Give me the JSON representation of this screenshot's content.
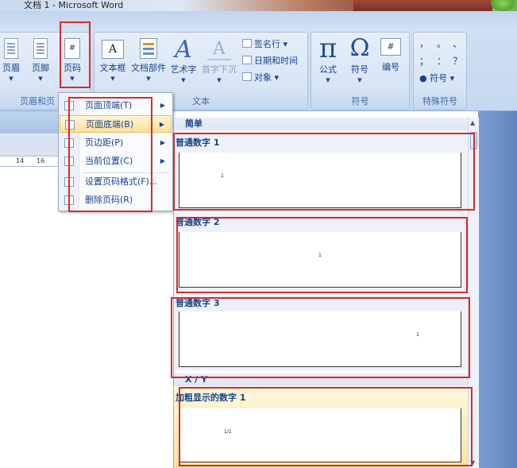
{
  "window": {
    "title": "文档 1 - Microsoft Word"
  },
  "ribbon": {
    "header_footer_group": {
      "label": "页眉和页",
      "header_button": "页眉",
      "footer_button": "页脚",
      "page_number_button": "页码",
      "page_number_icon_text": "#"
    },
    "text_group": {
      "label": "文本",
      "textbox_button": "文本框",
      "parts_button": "文档部件",
      "wordart_button": "艺术字",
      "dropcap_button": "首字下沉",
      "signature_line": "签名行",
      "date_time": "日期和时间",
      "object": "对象",
      "textbox_icon_text": "A",
      "wordart_icon_text": "A",
      "dropcap_icon_text": "A"
    },
    "symbols_group": {
      "label": "符号",
      "equation_button": "公式",
      "symbol_button": "符号",
      "numbering_button": "编号",
      "equation_icon_text": "π",
      "symbol_icon_text": "Ω",
      "numbering_icon_text": "#"
    },
    "special_symbols_group": {
      "label": "特殊符号",
      "symbols": [
        "，",
        "。",
        "、",
        "；",
        "：",
        "？"
      ],
      "symbol_dropdown": "符号"
    }
  },
  "ruler": {
    "ticks": [
      "14",
      "16"
    ]
  },
  "context_menu": {
    "items": [
      {
        "label": "页面顶端(T)",
        "has_submenu": true
      },
      {
        "label": "页面底端(B)",
        "has_submenu": true
      },
      {
        "label": "页边距(P)",
        "has_submenu": true
      },
      {
        "label": "当前位置(C)",
        "has_submenu": true
      },
      {
        "label": "设置页码格式(F)...",
        "has_submenu": false
      },
      {
        "label": "删除页码(R)",
        "has_submenu": false
      }
    ],
    "active_item": "页面底端(B)"
  },
  "gallery": {
    "section_simple": "简单",
    "section_xy": "X / Y",
    "items": [
      {
        "title": "普通数字 1",
        "preview_number": "1"
      },
      {
        "title": "普通数字 2",
        "preview_number": "1"
      },
      {
        "title": "普通数字 3",
        "preview_number": "1"
      },
      {
        "title": "加粗显示的数字 1",
        "preview_number": "1/1"
      }
    ]
  },
  "colors": {
    "highlight_red": "#e0262c",
    "ribbon_text": "#15428b",
    "active_menu": "#ffe09a"
  }
}
